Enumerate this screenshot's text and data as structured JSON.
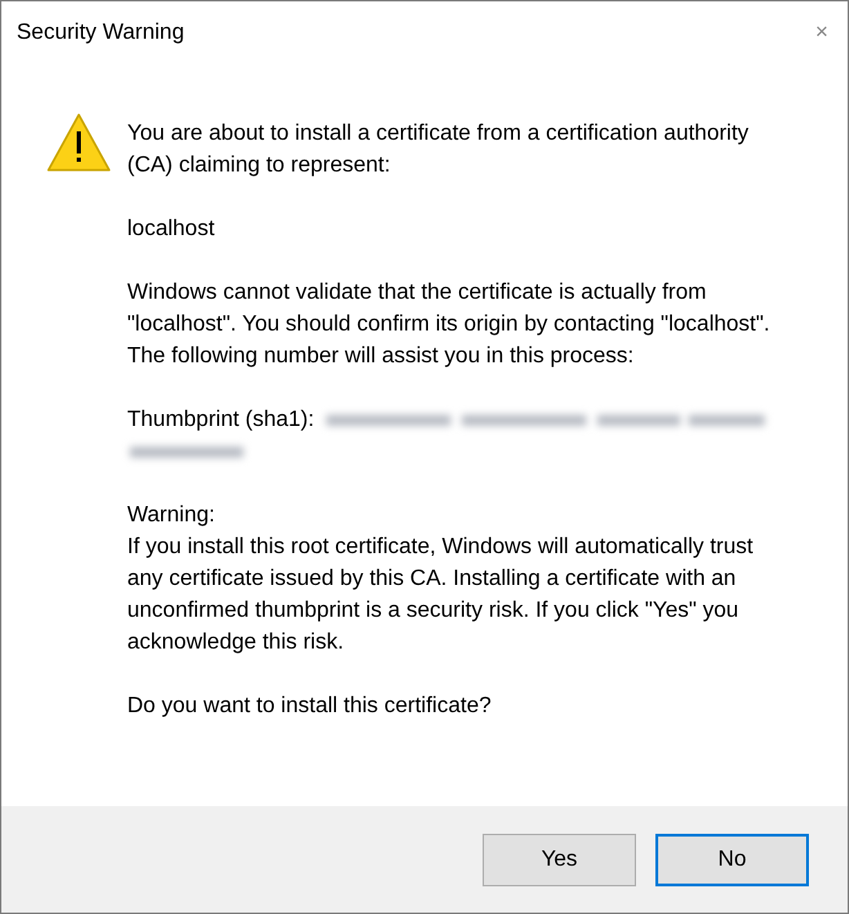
{
  "window": {
    "title": "Security Warning",
    "close": "×"
  },
  "message": {
    "intro": "You are about to install a certificate from a certification authority (CA) claiming to represent:",
    "subject": "localhost",
    "explanation": "Windows cannot validate that the certificate is actually from \"localhost\". You should confirm its origin by contacting \"localhost\". The following number will assist you in this process:",
    "thumbprint_label": "Thumbprint (sha1):",
    "warning_heading": "Warning:",
    "warning": "If you install this root certificate, Windows will automatically trust any certificate issued by this CA. Installing a certificate with an unconfirmed thumbprint is a security risk. If you click \"Yes\" you acknowledge this risk.",
    "question": "Do you want to install this certificate?"
  },
  "buttons": [
    {
      "label": "Yes",
      "default": false
    },
    {
      "label": "No",
      "default": true
    }
  ]
}
